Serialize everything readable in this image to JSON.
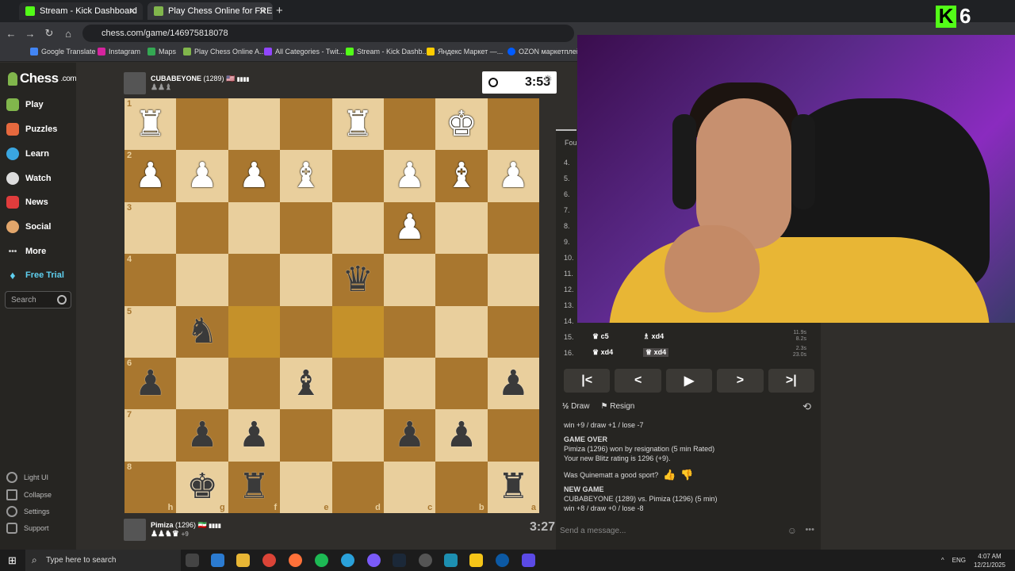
{
  "browser": {
    "tabs": [
      {
        "label": "Stream - Kick Dashboard",
        "active": false
      },
      {
        "label": "Play Chess Online for FREE",
        "active": true
      }
    ],
    "url": "chess.com/game/146975818078",
    "bookmarks": [
      "Google Translate",
      "Instagram",
      "Maps",
      "Play Chess Online A...",
      "All Categories - Twit...",
      "Stream - Kick Dashb...",
      "Яндекс Маркет —...",
      "OZON маркетплейс"
    ]
  },
  "overlay": {
    "kick_count": "6"
  },
  "sidebar": {
    "logo_text": "Chess",
    "logo_suffix": ".com",
    "items": [
      {
        "label": "Play",
        "icon": "play-pawn-icon",
        "color": "#81b64c"
      },
      {
        "label": "Puzzles",
        "icon": "puzzle-icon",
        "color": "#e6693e"
      },
      {
        "label": "Learn",
        "icon": "learn-icon",
        "color": "#3aa6e0"
      },
      {
        "label": "Watch",
        "icon": "watch-icon",
        "color": "#dddddd"
      },
      {
        "label": "News",
        "icon": "news-icon",
        "color": "#e03c3c"
      },
      {
        "label": "Social",
        "icon": "social-icon",
        "color": "#e2a66b"
      },
      {
        "label": "More",
        "icon": "more-icon",
        "color": "#cccccc"
      },
      {
        "label": "Free Trial",
        "icon": "diamond-icon",
        "color": "#5fd0f0"
      }
    ],
    "search_placeholder": "Search",
    "bottom": [
      {
        "label": "Light UI"
      },
      {
        "label": "Collapse"
      },
      {
        "label": "Settings"
      },
      {
        "label": "Support"
      }
    ]
  },
  "opponent": {
    "name": "CUBABEYONE",
    "rating": "(1289)",
    "flag": "🇺🇸",
    "bars": "▮▮▮▮",
    "captured": "♟♟♝",
    "clock": "3:53"
  },
  "me": {
    "name": "Pimiza",
    "rating": "(1296)",
    "flag": "🇮🇷",
    "bars": "▮▮▮▮",
    "captured": "♟♟♞♛",
    "advantage": "+9",
    "clock": "3:27"
  },
  "board": {
    "ranks": [
      "1",
      "2",
      "3",
      "4",
      "5",
      "6",
      "7",
      "8"
    ],
    "files": [
      "h",
      "g",
      "f",
      "e",
      "d",
      "c",
      "b",
      "a"
    ],
    "highlight": [
      "4-2",
      "4-4"
    ],
    "pieces": [
      [
        "♜",
        "",
        "",
        "",
        "♜",
        "",
        "♚",
        ""
      ],
      [
        "♟",
        "♟",
        "♟",
        "♝",
        "",
        "♟",
        "♝",
        "♟"
      ],
      [
        "",
        "",
        "",
        "",
        "",
        "♟",
        "",
        ""
      ],
      [
        "",
        "",
        "",
        "",
        "♛",
        "",
        "",
        ""
      ],
      [
        "",
        "♞",
        "",
        "",
        "",
        "",
        "",
        ""
      ],
      [
        "♟",
        "",
        "",
        "♝",
        "",
        "",
        "",
        "♟"
      ],
      [
        "",
        "♟",
        "♟",
        "",
        "",
        "♟",
        "♟",
        ""
      ],
      [
        "",
        "♚",
        "♜",
        "",
        "",
        "",
        "",
        "♜"
      ]
    ],
    "colors": [
      [
        "w",
        "",
        "",
        "",
        "w",
        "",
        "w",
        ""
      ],
      [
        "w",
        "w",
        "w",
        "w",
        "",
        "w",
        "w",
        "w"
      ],
      [
        "",
        "",
        "",
        "",
        "",
        "w",
        "",
        ""
      ],
      [
        "",
        "",
        "",
        "",
        "b",
        "",
        "",
        ""
      ],
      [
        "",
        "b",
        "",
        "",
        "",
        "",
        "",
        ""
      ],
      [
        "b",
        "",
        "",
        "b",
        "",
        "",
        "",
        "b"
      ],
      [
        "",
        "b",
        "b",
        "",
        "",
        "b",
        "b",
        ""
      ],
      [
        "",
        "b",
        "b",
        "",
        "",
        "",
        "",
        "b"
      ]
    ]
  },
  "moves": {
    "tab": "Four",
    "rows": [
      {
        "n": "4.",
        "w": "",
        "b": ""
      },
      {
        "n": "5.",
        "w": "",
        "b": ""
      },
      {
        "n": "6.",
        "w": "",
        "b": ""
      },
      {
        "n": "7.",
        "w": "",
        "b": ""
      },
      {
        "n": "8.",
        "w": "",
        "b": ""
      },
      {
        "n": "9.",
        "w": "",
        "b": ""
      },
      {
        "n": "10.",
        "w": "",
        "b": ""
      },
      {
        "n": "11.",
        "w": "",
        "b": ""
      },
      {
        "n": "12.",
        "w": "",
        "b": ""
      },
      {
        "n": "13.",
        "w": "",
        "b": ""
      },
      {
        "n": "14.",
        "w": "",
        "b": ""
      },
      {
        "n": "15.",
        "w": "♛ c5",
        "b": "♗ xd4",
        "t1": "11.9s",
        "t2": "8.2s"
      },
      {
        "n": "16.",
        "w": "♛ xd4",
        "b": "♕ xd4",
        "t1": "2.3s",
        "t2": "23.0s"
      }
    ]
  },
  "controls": {
    "first": "|<",
    "prev": "<",
    "play": "▶",
    "next": ">",
    "last": ">|"
  },
  "actions": {
    "draw": "Draw",
    "resign": "Resign"
  },
  "log": {
    "line0": "win +9 / draw +1 / lose -7",
    "game_over": "GAME OVER",
    "result": "Pimiza (1296) won by resignation (5 min Rated)",
    "rating_line": "Your new Blitz rating is 1296 (+9).",
    "sport_q": "Was Quinematt a good sport?",
    "new_game": "NEW GAME",
    "matchup": "CUBABEYONE (1289) vs. Pimiza (1296) (5 min)",
    "odds": "win +8 / draw +0 / lose -8"
  },
  "chat": {
    "placeholder": "Send a message..."
  },
  "taskbar": {
    "search": "Type here to search",
    "lang": "ENG",
    "time": "4:07 AM",
    "date": "12/21/2025"
  }
}
